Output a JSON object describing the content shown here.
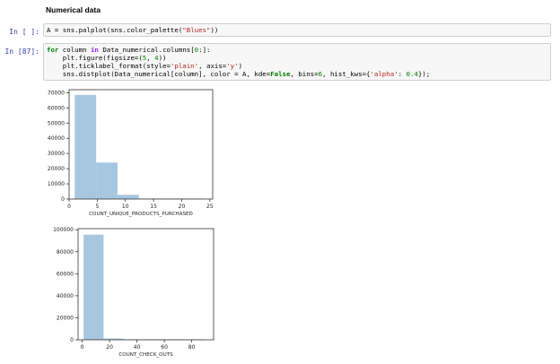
{
  "heading": "Numerical data",
  "cells": {
    "cell1": {
      "prompt": "In [ ]:",
      "lines": [
        "A = sns.palplot(sns.color_palette(\"Blues\"))"
      ]
    },
    "cell2": {
      "prompt": "In [87]:",
      "lines": [
        "for column in Data_numerical.columns[0:]:",
        "    plt.figure(figsize=(5, 4))",
        "    plt.ticklabel_format(style='plain', axis='y')",
        "    sns.distplot(Data_numerical[column], color = A, kde=False, bins=6, hist_kws={'alpha': 0.4});"
      ]
    }
  },
  "colors": {
    "bar": "#a7c6e0",
    "axes": "#333333"
  },
  "chart_data": [
    {
      "type": "bar",
      "title": "",
      "xlabel": "COUNT_UNIQUE_PRODUCTS_PURCHASED",
      "ylabel": "",
      "bins": [
        [
          1,
          4.8
        ],
        [
          4.8,
          8.6
        ],
        [
          8.6,
          12.4
        ],
        [
          12.4,
          16.2
        ],
        [
          16.2,
          20
        ],
        [
          20,
          23.8
        ]
      ],
      "values": [
        68500,
        24000,
        2800,
        300,
        100,
        30
      ],
      "xlim": [
        0,
        25.5
      ],
      "ylim": [
        0,
        72000
      ],
      "xticks": [
        0,
        5,
        10,
        15,
        20,
        25
      ],
      "yticks": [
        0,
        10000,
        20000,
        30000,
        40000,
        50000,
        60000,
        70000
      ]
    },
    {
      "type": "bar",
      "title": "",
      "xlabel": "COUNT_CHECK_OUTS",
      "ylabel": "",
      "bins": [
        [
          1,
          15.6
        ],
        [
          15.6,
          30.2
        ],
        [
          30.2,
          44.8
        ],
        [
          44.8,
          59.4
        ],
        [
          59.4,
          74
        ],
        [
          74,
          88.6
        ]
      ],
      "values": [
        95500,
        1200,
        200,
        60,
        20,
        10
      ],
      "xlim": [
        -3,
        96
      ],
      "ylim": [
        0,
        101000
      ],
      "xticks": [
        0,
        20,
        40,
        60,
        80
      ],
      "yticks": [
        0,
        20000,
        40000,
        60000,
        80000,
        100000
      ]
    }
  ]
}
